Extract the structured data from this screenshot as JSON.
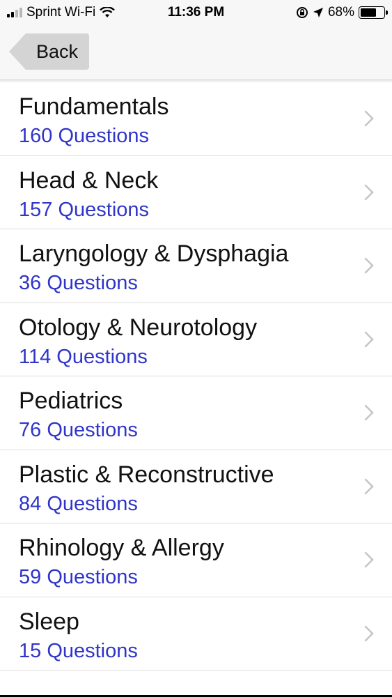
{
  "status_bar": {
    "carrier": "Sprint Wi-Fi",
    "time": "11:36 PM",
    "battery": "68%",
    "battery_level": 0.68,
    "icons": [
      "signal-icon",
      "wifi-icon",
      "orientation-lock-icon",
      "location-arrow-icon",
      "battery-icon"
    ]
  },
  "nav": {
    "back_label": "Back"
  },
  "list": {
    "items": [
      {
        "title": "Fundamentals",
        "subtitle": "160 Questions"
      },
      {
        "title": "Head & Neck",
        "subtitle": "157 Questions"
      },
      {
        "title": "Laryngology & Dysphagia",
        "subtitle": "36 Questions"
      },
      {
        "title": "Otology & Neurotology",
        "subtitle": "114 Questions"
      },
      {
        "title": "Pediatrics",
        "subtitle": "76 Questions"
      },
      {
        "title": "Plastic & Reconstructive",
        "subtitle": "84 Questions"
      },
      {
        "title": "Rhinology & Allergy",
        "subtitle": "59 Questions"
      },
      {
        "title": "Sleep",
        "subtitle": "15 Questions"
      }
    ]
  },
  "colors": {
    "subtitle": "#2f35c8",
    "bar_background": "#f7f7f7",
    "back_button": "#d4d4d4"
  }
}
